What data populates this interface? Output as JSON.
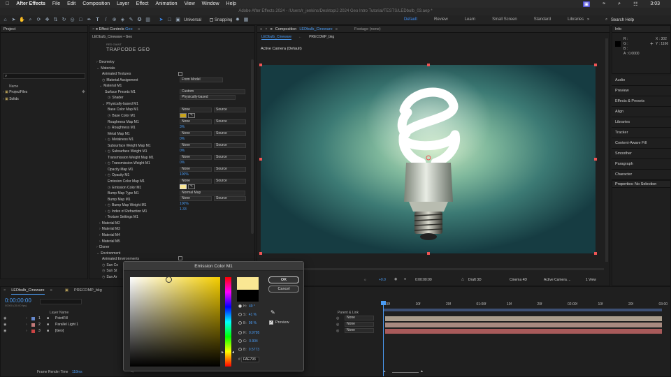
{
  "mac_menu": {
    "app": "After Effects",
    "items": [
      "File",
      "Edit",
      "Composition",
      "Layer",
      "Effect",
      "Animation",
      "View",
      "Window",
      "Help"
    ],
    "clock": "3:03"
  },
  "window_title": "Adobe After Effects 2024 - /Users/r_jenkins/Desktop/J 2024 Geo Intro Tutorial/TESTS/LEDbulb_03.aep *",
  "toolbar": {
    "universal_label": "Universal",
    "snapping_label": "Snapping",
    "workspaces": [
      "Default",
      "Review",
      "Learn",
      "Small Screen",
      "Standard",
      "Libraries"
    ],
    "search_placeholder": "Search Help"
  },
  "project_panel": {
    "title": "Project",
    "search_placeholder": "",
    "col_name": "Name",
    "items": [
      "ProjectFiles",
      "Solids"
    ]
  },
  "effect_controls": {
    "title": "Effect Controls",
    "layer_name": "Geo",
    "path": "LEDbulb_Cineware • Geo",
    "plugin_small": "RED GIANT",
    "plugin_name": "TRAPCODE GEO",
    "rows": [
      {
        "label": "Geometry",
        "indent": 0,
        "twirl": "›"
      },
      {
        "label": "Materials",
        "indent": 0,
        "twirl": "⌄"
      },
      {
        "label": "Animated Textures",
        "indent": 2,
        "twirl": ""
      },
      {
        "label": "Material Assignment",
        "indent": 2,
        "twirl": "",
        "stopwatch": true
      },
      {
        "label": "Material  M1",
        "indent": 1,
        "twirl": "⌄"
      },
      {
        "label": "Surface Presets  M1",
        "indent": 3,
        "twirl": ""
      },
      {
        "label": "Shader",
        "indent": 4,
        "twirl": "",
        "stopwatch": true
      },
      {
        "label": "Physically-based  M1",
        "indent": 2,
        "twirl": "⌄"
      },
      {
        "label": "Base Color Map  M1",
        "indent": 4,
        "twirl": ""
      },
      {
        "label": "Base Color  M1",
        "indent": 4,
        "twirl": "",
        "stopwatch": true
      },
      {
        "label": "Roughness Map  M1",
        "indent": 4,
        "twirl": ""
      },
      {
        "label": "Roughness  M1",
        "indent": 3,
        "twirl": "›",
        "stopwatch": true
      },
      {
        "label": "Metal Map  M1",
        "indent": 4,
        "twirl": ""
      },
      {
        "label": "Metalness  M1",
        "indent": 3,
        "twirl": "›",
        "stopwatch": true
      },
      {
        "label": "Subsurface Weight Map  M1",
        "indent": 4,
        "twirl": ""
      },
      {
        "label": "Subsurface Weight  M1",
        "indent": 3,
        "twirl": "›",
        "stopwatch": true
      },
      {
        "label": "Transmission Weight Map  M1",
        "indent": 4,
        "twirl": ""
      },
      {
        "label": "Transmission Weight  M1",
        "indent": 3,
        "twirl": "›",
        "stopwatch": true
      },
      {
        "label": "Opacity Map  M1",
        "indent": 4,
        "twirl": ""
      },
      {
        "label": "Opacity  M1",
        "indent": 3,
        "twirl": "›",
        "stopwatch": true
      },
      {
        "label": "Emission Color Map  M1",
        "indent": 4,
        "twirl": ""
      },
      {
        "label": "Emission Color  M1",
        "indent": 4,
        "twirl": "",
        "stopwatch": true
      },
      {
        "label": "Bump Map Type  M1",
        "indent": 4,
        "twirl": ""
      },
      {
        "label": "Bump Map  M1",
        "indent": 4,
        "twirl": ""
      },
      {
        "label": "Bump Map Weight  M1",
        "indent": 3,
        "twirl": "›",
        "stopwatch": true
      },
      {
        "label": "Index of Refraction  M1",
        "indent": 3,
        "twirl": "›",
        "stopwatch": true
      },
      {
        "label": "Texture Settings  M1",
        "indent": 3,
        "twirl": "›"
      },
      {
        "label": "Material  M2",
        "indent": 1,
        "twirl": "›"
      },
      {
        "label": "Material  M3",
        "indent": 1,
        "twirl": "›"
      },
      {
        "label": "Material  M4",
        "indent": 1,
        "twirl": "›"
      },
      {
        "label": "Material  M5",
        "indent": 1,
        "twirl": "›"
      },
      {
        "label": "Cloner",
        "indent": 0,
        "twirl": "›"
      },
      {
        "label": "Environment",
        "indent": 0,
        "twirl": "⌄"
      },
      {
        "label": "Animated Environments",
        "indent": 2,
        "twirl": ""
      },
      {
        "label": "Sun Co",
        "indent": 2,
        "twirl": "",
        "stopwatch": true
      },
      {
        "label": "Sun St",
        "indent": 2,
        "twirl": "",
        "stopwatch": true
      },
      {
        "label": "Sun Ar",
        "indent": 2,
        "twirl": "",
        "stopwatch": true
      }
    ],
    "values": {
      "material_assignment": "From Model",
      "surface_presets": "Custom",
      "shader": "Physically-based",
      "base_color_map": "None",
      "base_color_map_src": "Source",
      "roughness_map": "None",
      "roughness_map_src": "Source",
      "roughness": "3%",
      "metal_map": "None",
      "metal_map_src": "Source",
      "metalness": "0%",
      "subsurface_map": "None",
      "subsurface_map_src": "Source",
      "subsurface": "0%",
      "transmission_map": "None",
      "transmission_map_src": "Source",
      "transmission": "0%",
      "opacity_map": "None",
      "opacity_map_src": "Source",
      "opacity": "100%",
      "emission_map": "None",
      "emission_map_src": "Source",
      "bump_type": "Normal Map",
      "bump_map": "None",
      "bump_map_src": "Source",
      "bump_weight": "100%",
      "ior": "1.33"
    },
    "colors": {
      "base": "#c9a41c",
      "emission": "#fae793"
    }
  },
  "composition": {
    "tab_label": "Composition",
    "comp_name": "LEDbulb_Cineware",
    "footage_label": "Footage (none)",
    "sub_tabs": [
      "LEDbulb_Cineware",
      "PRECOMP_bkg"
    ],
    "camera_label": "Active Camera (Default)",
    "footer": {
      "exposure": "+0.0",
      "timecode": "0:00:00:00",
      "draft": "Draft 3D",
      "renderer": "Cinema 4D",
      "camera": "Active Camera ...",
      "view": "1 View"
    }
  },
  "info_panel": {
    "title": "Info",
    "r": "R :",
    "g": "G :",
    "b": "B :",
    "a": "A :  0.0000",
    "x": "X : 302",
    "y": "Y : 1166"
  },
  "right_panels": [
    "Audio",
    "Preview",
    "Effects & Presets",
    "Align",
    "Libraries",
    "Tracker",
    "Content-Aware Fill",
    "Smoother",
    "Paragraph",
    "Character"
  ],
  "properties_title": "Properties: No Selection",
  "color_dialog": {
    "title": "Emission Color  M1",
    "ok": "OK",
    "cancel": "Cancel",
    "preview_label": "Preview",
    "hsb": [
      {
        "label": "H:",
        "value": "49 °"
      },
      {
        "label": "S:",
        "value": "41 %"
      },
      {
        "label": "B:",
        "value": "98 %"
      },
      {
        "label": "R:",
        "value": "0.9795"
      },
      {
        "label": "G:",
        "value": "0.904"
      },
      {
        "label": "B:",
        "value": "0.5773"
      }
    ],
    "hex_label": "#",
    "hex": "FAE793",
    "new_color": "#fae793",
    "old_color": "#000000"
  },
  "timeline": {
    "tabs": [
      "LEDbulb_Cineware",
      "PRECOMP_bkg"
    ],
    "timecode": "0:00:00:00",
    "fps": "30 fps",
    "frame": "00000 (30.00 fps)",
    "col_layer_name": "Layer Name",
    "col_parent": "Parent & Link",
    "layers": [
      {
        "num": "1",
        "name": "PointFill",
        "color": "#6688cc",
        "parent": "None",
        "bar": "#a99c8c"
      },
      {
        "num": "2",
        "name": "Parallel Light 1",
        "color": "#c27a7a",
        "parent": "None",
        "bar": "#a88a80"
      },
      {
        "num": "3",
        "name": "[Geo]",
        "color": "#cc4444",
        "parent": "None",
        "bar": "#a85a5a"
      }
    ],
    "ruler": [
      "00f",
      "10f",
      "20f",
      "01:00f",
      "10f",
      "20f",
      "02:00f",
      "10f",
      "20f",
      "03:00"
    ],
    "render_time_label": "Frame Render Time",
    "render_time": "118ms",
    "bpc": "30 fps"
  }
}
